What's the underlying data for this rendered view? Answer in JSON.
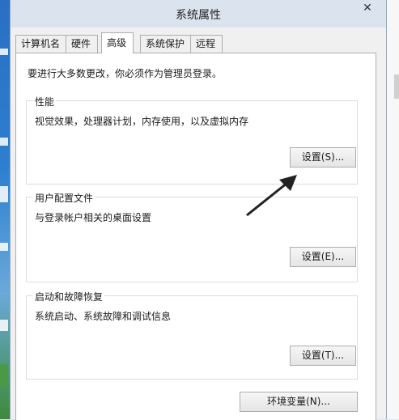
{
  "window": {
    "title": "系统属性",
    "close_glyph": "✕"
  },
  "tabs": [
    {
      "label": "计算机名"
    },
    {
      "label": "硬件"
    },
    {
      "label": "高级",
      "active": true
    },
    {
      "label": "系统保护"
    },
    {
      "label": "远程"
    }
  ],
  "advanced": {
    "admin_notice": "要进行大多数更改，你必须作为管理员登录。",
    "performance": {
      "title": "性能",
      "description": "视觉效果，处理器计划，内存使用，以及虚拟内存",
      "button": "设置(S)..."
    },
    "user_profiles": {
      "title": "用户配置文件",
      "description": "与登录帐户相关的桌面设置",
      "button": "设置(E)..."
    },
    "startup_recovery": {
      "title": "启动和故障恢复",
      "description": "系统启动、系统故障和调试信息",
      "button": "设置(T)..."
    },
    "env_button": "环境变量(N)..."
  },
  "colors": {
    "titlebar": "#dbe4ee",
    "panel": "#ffffff",
    "arrow": "#222222"
  },
  "icons": {
    "close": "close-icon",
    "arrow": "arrow-annotation-icon"
  }
}
